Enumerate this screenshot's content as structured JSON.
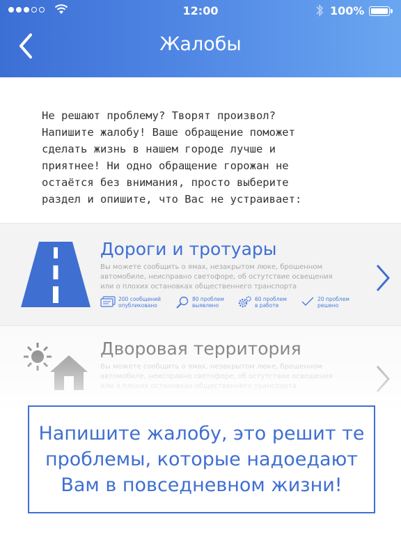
{
  "status_bar": {
    "time": "12:00",
    "battery": "100%",
    "icons": [
      "signal-dots-icon",
      "wifi-icon",
      "bluetooth-icon",
      "battery-icon"
    ]
  },
  "nav": {
    "title": "Жалобы",
    "back_icon": "chevron-left-icon"
  },
  "intro": {
    "line1": "Не решают проблему? Творят произвол?",
    "line2": "Напишите жалобу! Ваше обращение поможет",
    "line3": "сделать жизнь в нашем городе лучше и",
    "line4": "приятнее! Ни одно обращение горожан не",
    "line5": "остаётся без внимания, просто выберите",
    "line6": "раздел и опишите, что Вас не устраивает:"
  },
  "categories": [
    {
      "title": "Дороги и тротуары",
      "icon": "road-icon",
      "desc1": "Вы можете сообщить о ямах, незакрытом люке, брошенном",
      "desc2": "автомобиле, неисправно светофоре, об остутствие освещения",
      "desc3": "или о плохих остановках общественнего транспорта",
      "stats": [
        {
          "icon": "messages-icon",
          "line1": "200 сообщений",
          "line2": "опубликовано"
        },
        {
          "icon": "magnifier-icon",
          "line1": "80 проблем",
          "line2": "выявлено"
        },
        {
          "icon": "gears-icon",
          "line1": "60 проблем",
          "line2": "в работе"
        },
        {
          "icon": "check-icon",
          "line1": "20 проблем",
          "line2": "решено"
        }
      ]
    },
    {
      "title": "Дворовая территория",
      "icon": "house-sun-icon",
      "desc1": "Вы можете сообщить о ямах, незакрытом люке, брошенном",
      "desc2": "автомобиле, неисправно светофоре, об остутствие освещения",
      "desc3": "или о плохих остановках общественнего транспорта"
    }
  ],
  "callout": {
    "text": "Напишите жалобу, это решит те\nпроблемы, которые надоедают\nВам в повседневном жизни!"
  },
  "colors": {
    "accent": "#3f6fd0",
    "header_start": "#3c6fd4",
    "header_end": "#6aa6f0"
  }
}
